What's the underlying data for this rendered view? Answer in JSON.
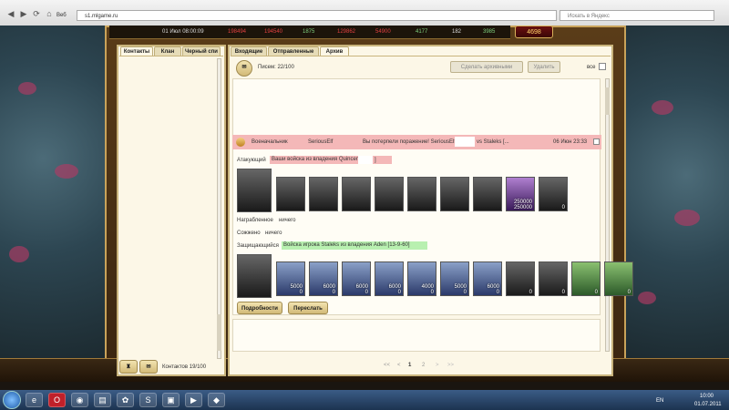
{
  "browser": {
    "tab_label": "Веб",
    "address": "s1.mlgame.ru",
    "search_placeholder": "Искать в Яндекс"
  },
  "resources": {
    "datetime": "01 Июл 08:00:09",
    "values": [
      "198494",
      "194540",
      "1875",
      "129862",
      "54900",
      "4177",
      "182",
      "3985"
    ],
    "gold": "4698"
  },
  "contacts": {
    "tabs": [
      "Контакты",
      "Клан",
      "Черный спи"
    ],
    "count_label": "Контактов 19/100"
  },
  "mail": {
    "tabs": [
      "Входящие",
      "Отправленные",
      "Архив"
    ],
    "letters_label": "Писем: 22/100",
    "btn_archive": "Сделать архивными",
    "btn_delete": "Удалить",
    "all_label": "все",
    "message": {
      "sender": "Военачальник",
      "recipient": "SeriousElf",
      "subject": "Вы потерпели поражение! SeriousElf",
      "subject_tail": "vs Staleks [...",
      "date": "06 Июн 23:33"
    },
    "attacker_label": "Атакующий",
    "attacker_value": "Ваши войска из владения Quincen",
    "attacker_tail": "]",
    "looted_label": "Награбленное",
    "looted_value": "ничего",
    "burned_label": "Сожжено",
    "burned_value": "ничего",
    "defender_label": "Защищающийся",
    "defender_value": "Войска игрока Staleks из владения Aden [13-9-60]",
    "attacker_units": [
      {
        "count": "",
        "loss": ""
      },
      {
        "count": "",
        "loss": ""
      },
      {
        "count": "",
        "loss": ""
      },
      {
        "count": "",
        "loss": ""
      },
      {
        "count": "",
        "loss": ""
      },
      {
        "count": "",
        "loss": ""
      },
      {
        "count": "",
        "loss": ""
      },
      {
        "count": "250000",
        "loss": "250000"
      },
      {
        "count": "",
        "loss": "0"
      }
    ],
    "defender_units": [
      {
        "count": "5000",
        "loss": "0"
      },
      {
        "count": "6000",
        "loss": "0"
      },
      {
        "count": "6000",
        "loss": "0"
      },
      {
        "count": "6000",
        "loss": "0"
      },
      {
        "count": "4000",
        "loss": "0"
      },
      {
        "count": "5000",
        "loss": "0"
      },
      {
        "count": "6000",
        "loss": "0"
      },
      {
        "count": "",
        "loss": "0"
      },
      {
        "count": "",
        "loss": "0"
      },
      {
        "count": "",
        "loss": "0"
      },
      {
        "count": "",
        "loss": "0"
      }
    ],
    "btn_details": "Подробности",
    "btn_forward": "Переслать",
    "pagination": {
      "first": "<<",
      "prev": "<",
      "current": "1",
      "next_page": "2",
      "next": ">",
      "last": ">>"
    }
  },
  "taskbar": {
    "lang": "EN",
    "time": "10:00",
    "date": "01.07.2011"
  }
}
